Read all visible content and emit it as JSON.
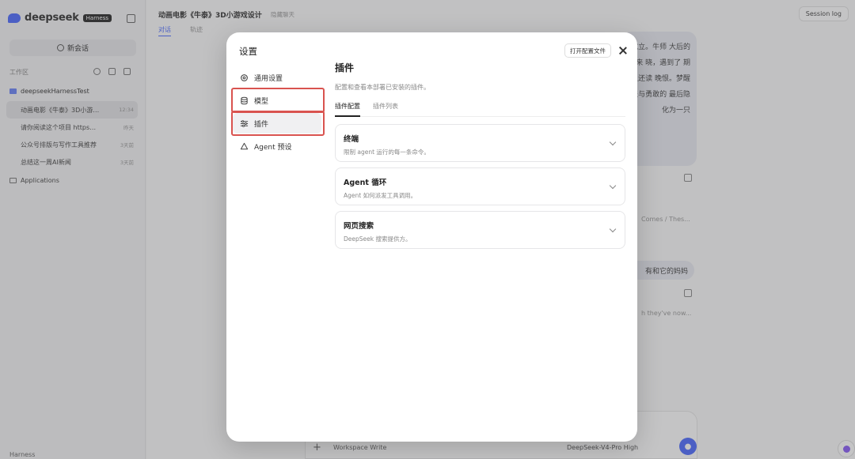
{
  "sidebar": {
    "brand": "deepseek",
    "badge": "Harness",
    "new_chat": "新会话",
    "workspace_label": "工作区",
    "project": "deepseekHarnessTest",
    "chats": [
      {
        "title": "动画电影《牛泰》3D小游…",
        "time": "12:34",
        "active": true
      },
      {
        "title": "请你阅读这个项目 https…",
        "time": "昨天",
        "active": false
      },
      {
        "title": "公众号排版与写作工具推荐",
        "time": "3天前",
        "active": false
      },
      {
        "title": "总结这一周AI新闻",
        "time": "3天前",
        "active": false
      }
    ],
    "apps": "Applications",
    "bottom": "Harness"
  },
  "main": {
    "title": "动画电影《牛泰》3D小游戏设计",
    "title_hint": "隐藏聊天",
    "tabs": [
      "对话",
      "轨迹"
    ],
    "session_log": "Session log",
    "bubble_text": "就立。牛师 大后的牛来 晓，遇到了 期上还读 晚恨。梦醒 提与勇敢的 最后隐化为一只",
    "line1": "Comes / Thes...",
    "bubble2": "有和它的妈妈",
    "line2": "h they've now...",
    "input_workspace": "Workspace Write",
    "input_model": "DeepSeek-V4-Pro High",
    "input_plus": "+"
  },
  "modal": {
    "title": "设置",
    "open_config": "打开配置文件",
    "nav": [
      {
        "label": "通用设置",
        "icon": "gear-icon",
        "selected": false,
        "marked": false
      },
      {
        "label": "模型",
        "icon": "database-icon",
        "selected": false,
        "marked": true
      },
      {
        "label": "插件",
        "icon": "sliders-icon",
        "selected": true,
        "marked": true
      },
      {
        "label": "Agent 预设",
        "icon": "recycle-icon",
        "selected": false,
        "marked": false
      }
    ],
    "content_title": "插件",
    "content_desc": "配置和查看本部署已安装的插件。",
    "tabs": [
      "插件配置",
      "插件列表"
    ],
    "cards": [
      {
        "title": "终端",
        "desc": "限制 agent 运行的每一条命令。"
      },
      {
        "title": "Agent 循环",
        "desc": "Agent 如何派发工具调用。"
      },
      {
        "title": "网页搜索",
        "desc": "DeepSeek 搜索提供方。"
      }
    ]
  },
  "colors": {
    "accent": "#4d6bfe",
    "highlight_border": "#d9534f"
  }
}
